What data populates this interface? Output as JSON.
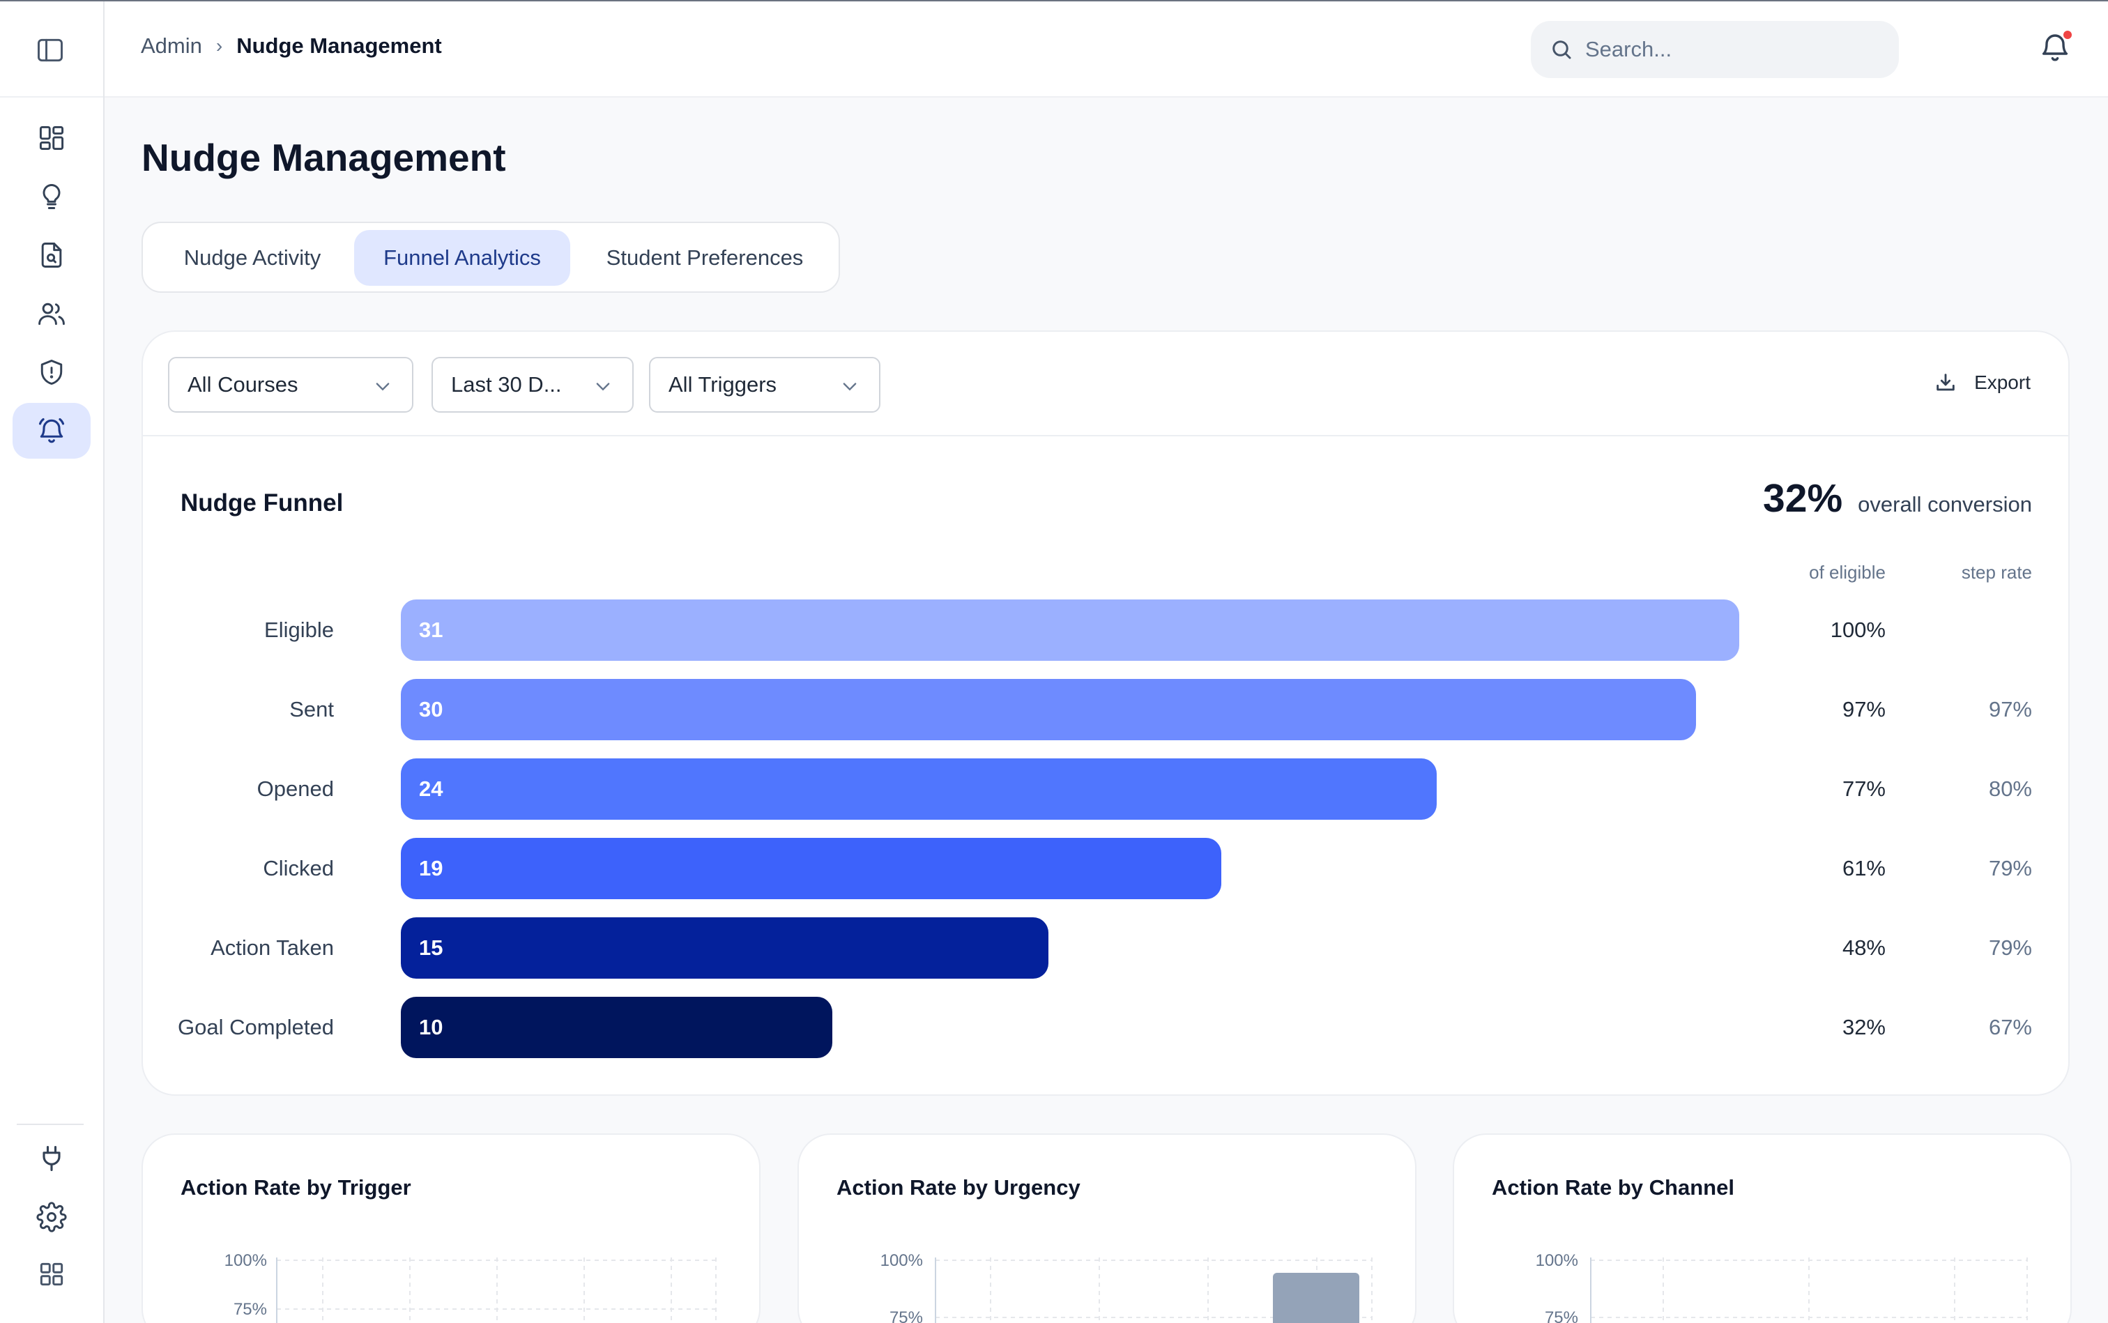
{
  "breadcrumb": {
    "root": "Admin",
    "separator": "›",
    "current": "Nudge Management"
  },
  "header": {
    "search_placeholder": "Search...",
    "notification_dot": true
  },
  "sidebar": {
    "items": [
      {
        "icon": "dashboard-icon",
        "active": false
      },
      {
        "icon": "lightbulb-icon",
        "active": false
      },
      {
        "icon": "document-search-icon",
        "active": false
      },
      {
        "icon": "users-icon",
        "active": false
      },
      {
        "icon": "shield-alert-icon",
        "active": false
      },
      {
        "icon": "alarm-bell-icon",
        "active": true
      }
    ],
    "bottom_items": [
      {
        "icon": "plug-icon"
      },
      {
        "icon": "gear-icon"
      },
      {
        "icon": "apps-grid-icon"
      }
    ]
  },
  "page": {
    "title": "Nudge Management"
  },
  "tabs": [
    {
      "label": "Nudge Activity",
      "active": false
    },
    {
      "label": "Funnel Analytics",
      "active": true
    },
    {
      "label": "Student Preferences",
      "active": false
    }
  ],
  "filters": {
    "course": "All Courses",
    "period": "Last 30 D...",
    "trigger": "All Triggers",
    "export_label": "Export"
  },
  "funnel": {
    "title": "Nudge Funnel",
    "overall_value": "32%",
    "overall_label": "overall conversion",
    "col_of_eligible": "of eligible",
    "col_step_rate": "step rate",
    "stages": [
      {
        "label": "Eligible",
        "count": "31",
        "of_eligible": "100%",
        "step_rate": "",
        "color": "#9bb0ff"
      },
      {
        "label": "Sent",
        "count": "30",
        "of_eligible": "97%",
        "step_rate": "97%",
        "color": "#6e8bff"
      },
      {
        "label": "Opened",
        "count": "24",
        "of_eligible": "77%",
        "step_rate": "80%",
        "color": "#5076fe"
      },
      {
        "label": "Clicked",
        "count": "19",
        "of_eligible": "61%",
        "step_rate": "79%",
        "color": "#3d62fb"
      },
      {
        "label": "Action Taken",
        "count": "15",
        "of_eligible": "48%",
        "step_rate": "79%",
        "color": "#04219b"
      },
      {
        "label": "Goal Completed",
        "count": "10",
        "of_eligible": "32%",
        "step_rate": "67%",
        "color": "#00155d"
      }
    ]
  },
  "mini_charts": [
    {
      "title": "Action Rate by Trigger",
      "ticks": [
        "100%",
        "75%"
      ]
    },
    {
      "title": "Action Rate by Urgency",
      "ticks": [
        "100%",
        "75%"
      ],
      "bar_colors": [
        "#0ea5e9",
        "#94a3b8"
      ]
    },
    {
      "title": "Action Rate by Channel",
      "ticks": [
        "100%",
        "75%"
      ],
      "bar_colors": [
        "#3b63f5"
      ]
    }
  ]
}
